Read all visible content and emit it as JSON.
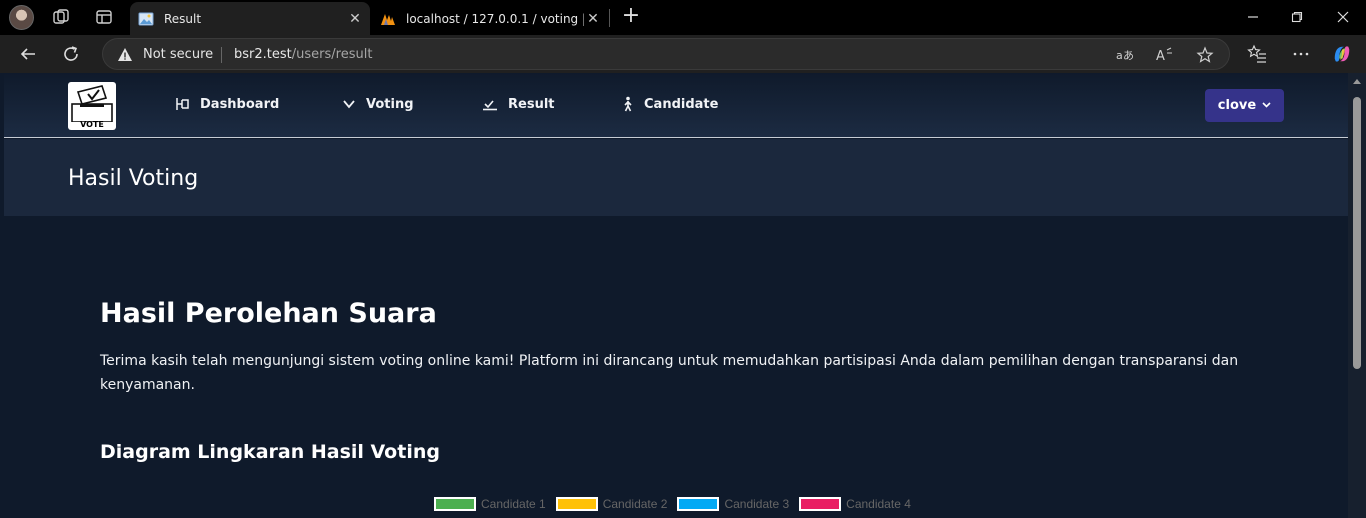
{
  "browser": {
    "tabs": [
      {
        "title": "Result",
        "favicon": "image-icon",
        "active": true
      },
      {
        "title": "localhost / 127.0.0.1 / voting | phpMyAdmin",
        "favicon": "phpmyadmin-icon",
        "active": false
      }
    ],
    "address": {
      "security_label": "Not secure",
      "host": "bsr2.test",
      "path": "/users/result"
    }
  },
  "site": {
    "logo_text": "VOTE",
    "nav": [
      {
        "label": "Dashboard",
        "icon": "dashboard-icon"
      },
      {
        "label": "Voting",
        "icon": "chevron-down-icon"
      },
      {
        "label": "Result",
        "icon": "result-icon"
      },
      {
        "label": "Candidate",
        "icon": "person-icon"
      }
    ],
    "user_menu": {
      "label": "clove"
    }
  },
  "page": {
    "title": "Hasil Voting",
    "heading": "Hasil Perolehan Suara",
    "description": "Terima kasih telah mengunjungi sistem voting online kami! Platform ini dirancang untuk memudahkan partisipasi Anda dalam pemilihan dengan transparansi dan kenyamanan.",
    "chart_heading": "Diagram Lingkaran Hasil Voting"
  },
  "chart_data": {
    "type": "pie",
    "title": "",
    "legend_position": "top",
    "categories": [
      "Candidate 1",
      "Candidate 2",
      "Candidate 3",
      "Candidate 4"
    ],
    "colors": [
      "#4caf50",
      "#ffc107",
      "#03a9f4",
      "#e91e63"
    ]
  }
}
